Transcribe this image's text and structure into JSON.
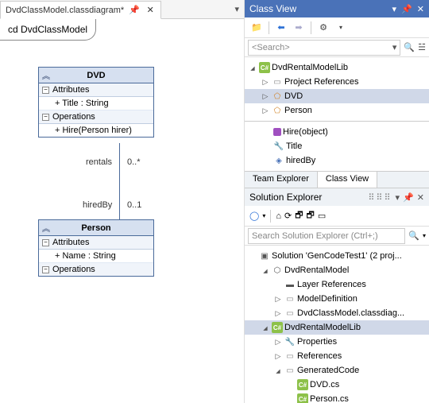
{
  "tabs": {
    "doc": "DvdClassModel.classdiagram*"
  },
  "diagram": {
    "title": "cd DvdClassModel",
    "class1": {
      "name": "DVD",
      "attr_label": "Attributes",
      "attr1": "+ Title : String",
      "op_label": "Operations",
      "op1": "+ Hire(Person hirer)"
    },
    "assoc": {
      "role1": "rentals",
      "mult1": "0..*",
      "role2": "hiredBy",
      "mult2": "0..1"
    },
    "class2": {
      "name": "Person",
      "attr_label": "Attributes",
      "attr1": "+ Name : String",
      "op_label": "Operations"
    }
  },
  "classview": {
    "title": "Class View",
    "search_placeholder": "<Search>",
    "tree": {
      "root": "DvdRentalModelLib",
      "projref": "Project References",
      "dvd": "DVD",
      "person": "Person"
    },
    "members": {
      "hire": "Hire(object)",
      "title": "Title",
      "hiredby": "hiredBy"
    },
    "tab1": "Team Explorer",
    "tab2": "Class View"
  },
  "solexp": {
    "header": "Solution Explorer",
    "search_placeholder": "Search Solution Explorer (Ctrl+;)",
    "tree": {
      "sln": "Solution 'GenCodeTest1' (2 proj...",
      "model": "DvdRentalModel",
      "layerref": "Layer References",
      "modeldef": "ModelDefinition",
      "classdiag": "DvdClassModel.classdiag...",
      "lib": "DvdRentalModelLib",
      "props": "Properties",
      "refs": "References",
      "gen": "GeneratedCode",
      "dvdcs": "DVD.cs",
      "personcs": "Person.cs"
    }
  }
}
